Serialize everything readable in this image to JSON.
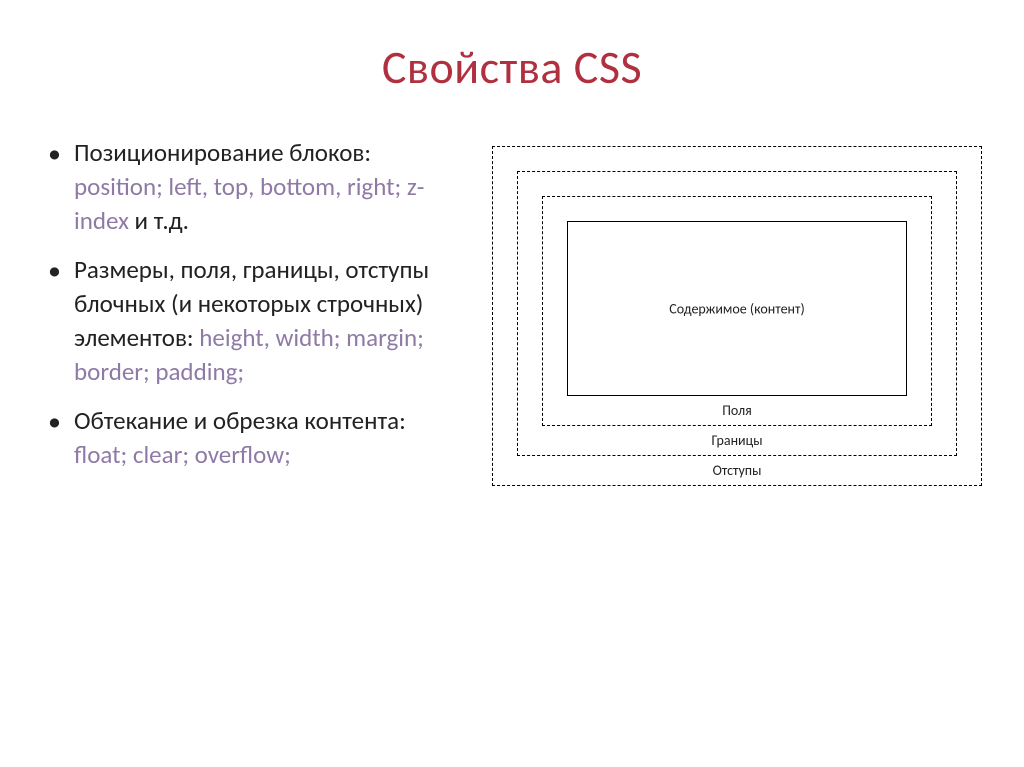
{
  "title": "Свойства CSS",
  "bullets": [
    {
      "pre": "Позиционирование блоков: ",
      "kw": "position; left, top, bottom, right; z-index ",
      "post": "и т.д."
    },
    {
      "pre": "Размеры, поля, границы, отступы блочных  (и некоторых строчных) элементов: ",
      "kw": "height, width; margin; border; padding;",
      "post": ""
    },
    {
      "pre": "Обтекание и обрезка контента: ",
      "kw": "float; clear; overflow;",
      "post": ""
    }
  ],
  "boxmodel": {
    "content": "Содержимое (контент)",
    "padding": "Поля",
    "border": "Границы",
    "margin": "Отступы"
  }
}
